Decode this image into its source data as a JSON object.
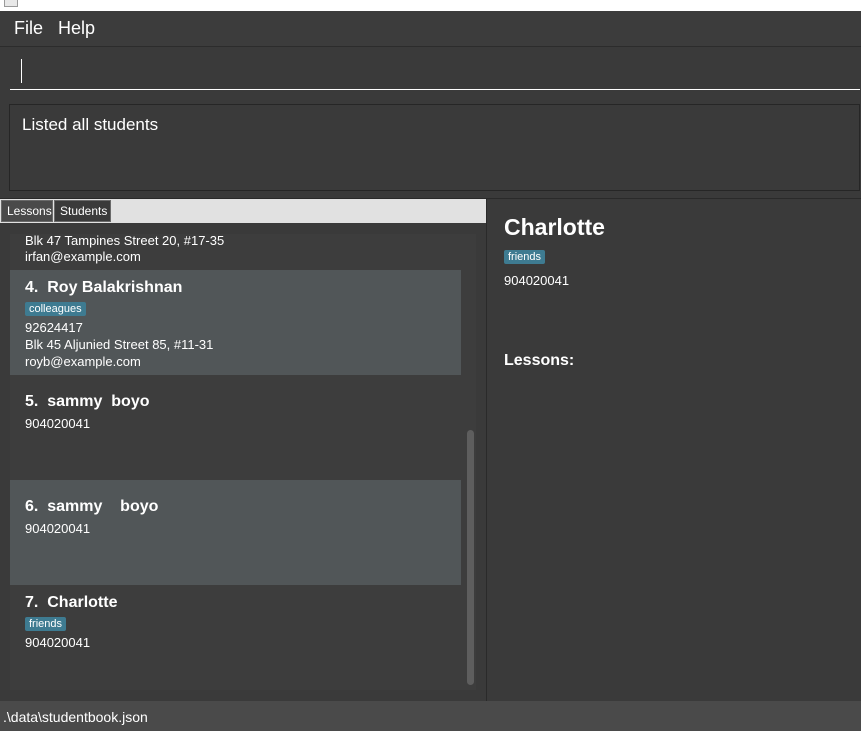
{
  "menu": {
    "file": "File",
    "help": "Help"
  },
  "command": {
    "value": "",
    "placeholder": ""
  },
  "result": {
    "text": "Listed all students"
  },
  "tabs": {
    "lessons": "Lessons",
    "students": "Students"
  },
  "students": [
    {
      "title": "",
      "tags": [],
      "phone": "",
      "address": "Blk 47 Tampines Street 20, #17-35",
      "email": "irfan@example.com"
    },
    {
      "title": "4.  Roy Balakrishnan",
      "tags": [
        "colleagues"
      ],
      "phone": "92624417",
      "address": "Blk 45 Aljunied Street 85, #11-31",
      "email": "royb@example.com"
    },
    {
      "title": "5.  sammy  boyo",
      "tags": [],
      "phone": "904020041",
      "address": "",
      "email": ""
    },
    {
      "title": "6.  sammy    boyo",
      "tags": [],
      "phone": "904020041",
      "address": "",
      "email": ""
    },
    {
      "title": "7.  Charlotte",
      "tags": [
        "friends"
      ],
      "phone": "904020041",
      "address": "",
      "email": ""
    }
  ],
  "detail": {
    "name": "Charlotte",
    "tag": "friends",
    "phone": "904020041",
    "lessons_label": "Lessons:"
  },
  "status": {
    "path": ".\\data\\studentbook.json"
  },
  "colors": {
    "tag": "#3e7b91",
    "selected_row": "#515658",
    "background": "#3a3a3a"
  }
}
